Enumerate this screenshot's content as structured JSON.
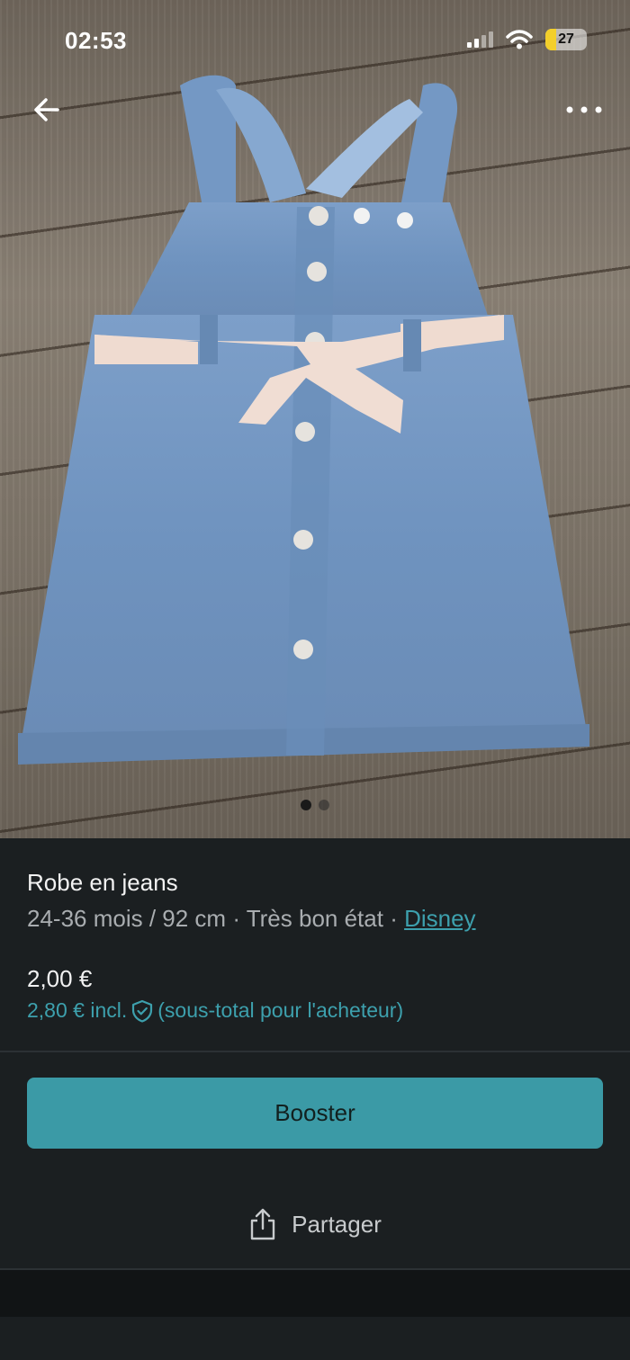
{
  "status_bar": {
    "time": "02:53",
    "battery": "27",
    "battery_level": 0.27
  },
  "header": {
    "back_icon": "arrow-left-icon",
    "more_icon": "more-horizontal-icon"
  },
  "gallery": {
    "image_count": 2,
    "active_index": 0
  },
  "item": {
    "title": "Robe en jeans",
    "size": "24-36 mois / 92 cm",
    "separator": " · ",
    "condition": "Très bon état",
    "brand": "Disney",
    "price": "2,00 €",
    "price_incl": "2,80 € incl.",
    "price_note": "(sous-total pour l'acheteur)"
  },
  "actions": {
    "boost_label": "Booster",
    "share_label": "Partager",
    "share_icon": "share-icon"
  },
  "colors": {
    "accent": "#3b9aa6",
    "link": "#3da0ad",
    "background": "#1b1f21"
  }
}
